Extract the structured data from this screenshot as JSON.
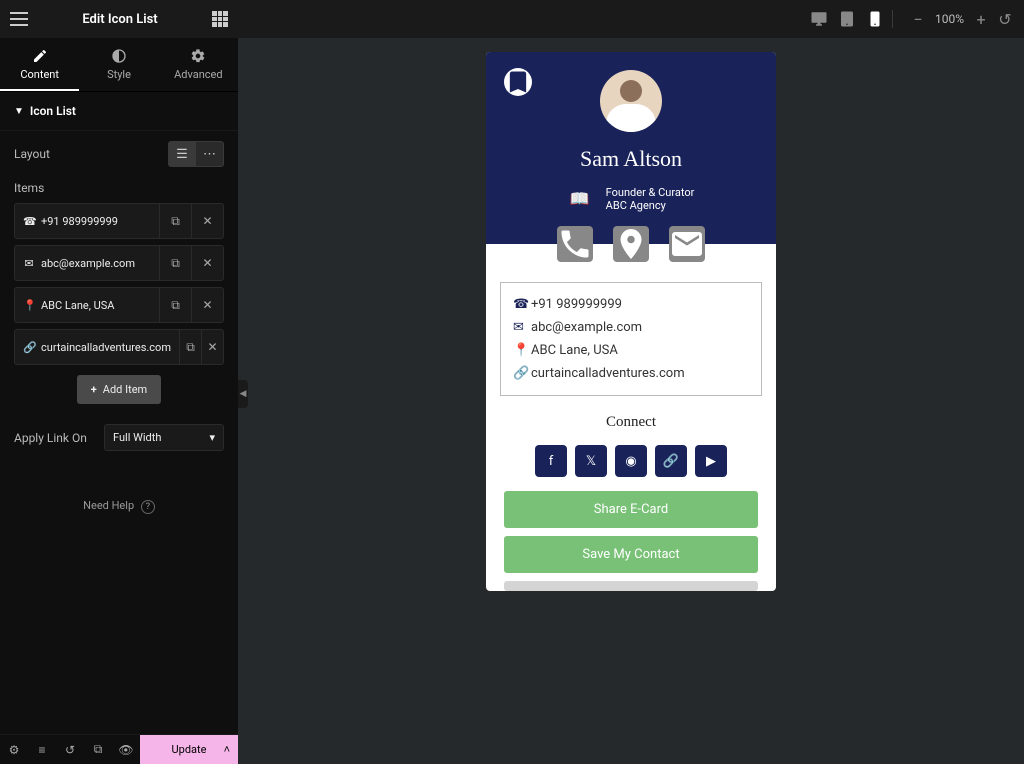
{
  "header": {
    "title": "Edit Icon List"
  },
  "tabs": {
    "content": "Content",
    "style": "Style",
    "advanced": "Advanced"
  },
  "section": {
    "icon_list": "Icon List"
  },
  "layout": {
    "label": "Layout"
  },
  "items": {
    "label": "Items",
    "list": [
      {
        "icon": "phone",
        "text": "+91 989999999"
      },
      {
        "icon": "envelope",
        "text": "abc@example.com"
      },
      {
        "icon": "map-pin",
        "text": "ABC Lane, USA"
      },
      {
        "icon": "link",
        "text": "curtaincalladventures.com"
      }
    ],
    "add_label": "Add Item"
  },
  "apply_link": {
    "label": "Apply Link On",
    "value": "Full Width"
  },
  "need_help": "Need Help",
  "footer": {
    "update": "Update"
  },
  "topbar": {
    "zoom": "100%"
  },
  "preview": {
    "name": "Sam Altson",
    "role1": "Founder & Curator",
    "role2": "ABC Agency",
    "contacts": [
      {
        "icon": "phone",
        "text": "+91 989999999"
      },
      {
        "icon": "envelope",
        "text": "abc@example.com"
      },
      {
        "icon": "map-pin",
        "text": "ABC Lane, USA"
      },
      {
        "icon": "link",
        "text": "curtaincalladventures.com"
      }
    ],
    "connect": "Connect",
    "share": "Share E-Card",
    "save": "Save My Contact"
  }
}
